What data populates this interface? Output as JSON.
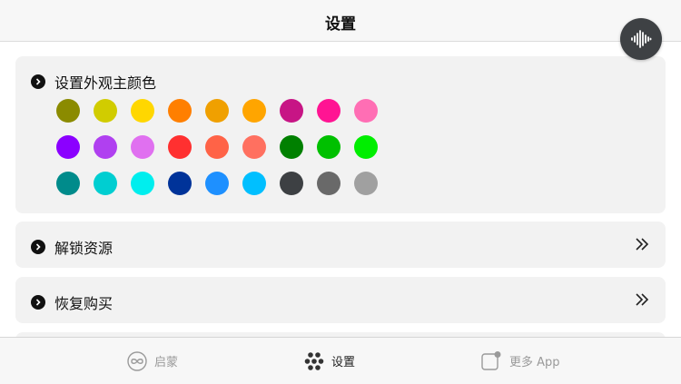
{
  "navbar": {
    "title": "设置"
  },
  "fab": {
    "icon": "sound-wave-icon"
  },
  "appearance": {
    "label": "设置外观主颜色",
    "colors": [
      "#8b8b00",
      "#d1cc00",
      "#ffd700",
      "#ff7f00",
      "#f0a000",
      "#ffa500",
      "#c71585",
      "#ff1493",
      "#ff6eb4",
      "#8b00ff",
      "#b040f0",
      "#e070f0",
      "#ff3030",
      "#ff6347",
      "#ff7060",
      "#008000",
      "#00c000",
      "#00ee00",
      "#008b8b",
      "#00ced1",
      "#00eeee",
      "#003399",
      "#1e90ff",
      "#00bfff",
      "#3d4043",
      "#696969",
      "#a0a0a0"
    ]
  },
  "unlock": {
    "label": "解锁资源"
  },
  "restore": {
    "label": "恢复购买"
  },
  "tabbar": {
    "tabs": [
      {
        "label": "启蒙",
        "icon": "infinity-icon",
        "active": false
      },
      {
        "label": "设置",
        "icon": "dots-cluster-icon",
        "active": true
      },
      {
        "label": "更多 App",
        "icon": "app-badge-icon",
        "active": false
      }
    ]
  }
}
